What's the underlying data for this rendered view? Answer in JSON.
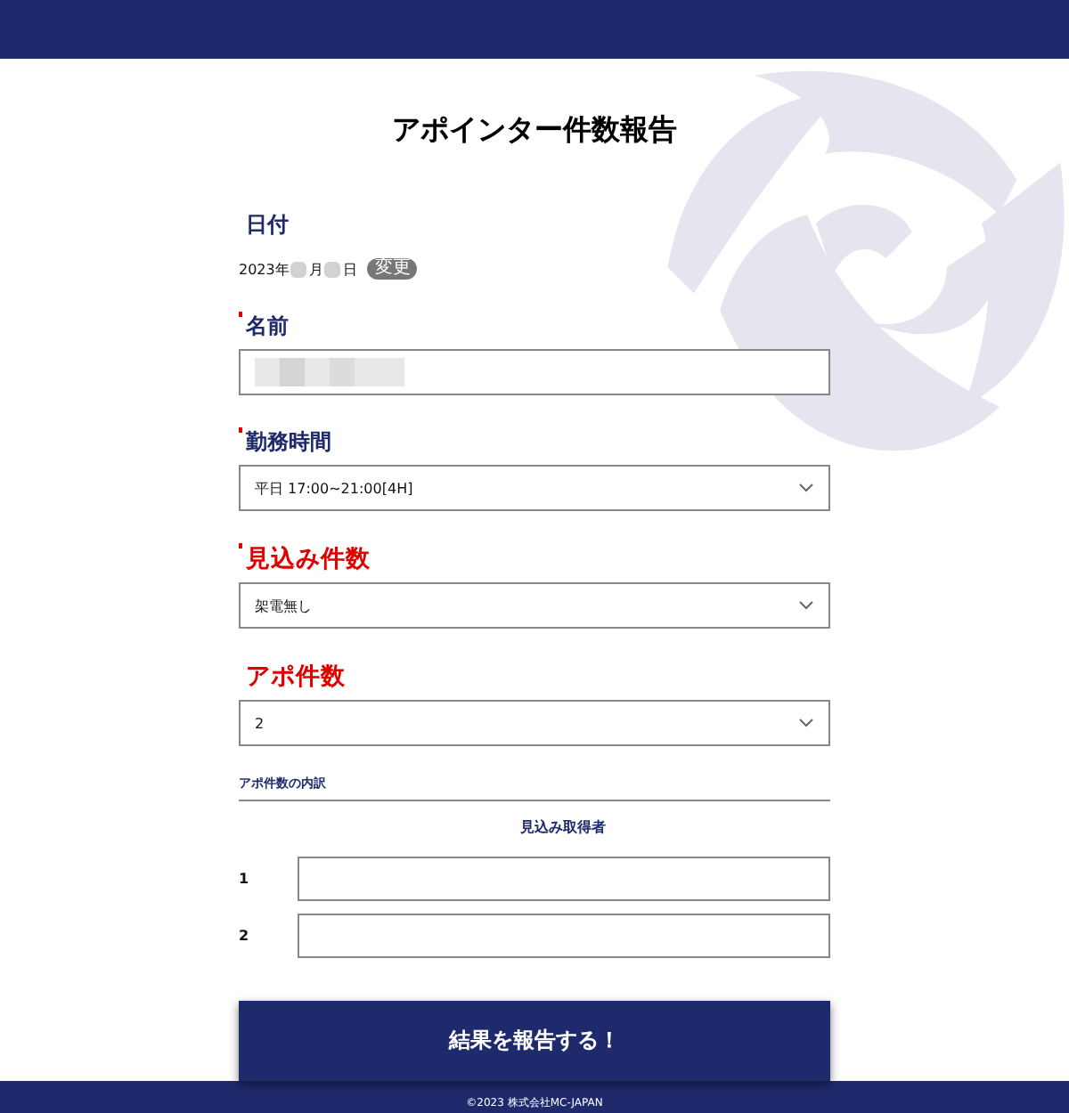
{
  "title": "アポインター件数報告",
  "date": {
    "label": "日付",
    "year": "2023年",
    "month": "月",
    "day": "日",
    "badge": "変更"
  },
  "fields": [
    {
      "label": "名前",
      "required": true,
      "highlight": false,
      "kind": "text",
      "redacted": true
    },
    {
      "label": "勤務時間",
      "required": true,
      "highlight": false,
      "kind": "select",
      "value": "平日 17:00~21:00[4H]"
    },
    {
      "label": "見込み件数",
      "required": true,
      "highlight": true,
      "kind": "select",
      "value": "架電無し"
    },
    {
      "label": "アポ件数",
      "required": false,
      "highlight": true,
      "kind": "select",
      "value": "2"
    }
  ],
  "breakdown": {
    "title": "アポ件数の内訳",
    "column": "見込み取得者",
    "rows": [
      {
        "number": "1"
      },
      {
        "number": "2"
      }
    ]
  },
  "submit": "結果を報告する！",
  "footer": "©2023 株式会社MC-JAPAN"
}
